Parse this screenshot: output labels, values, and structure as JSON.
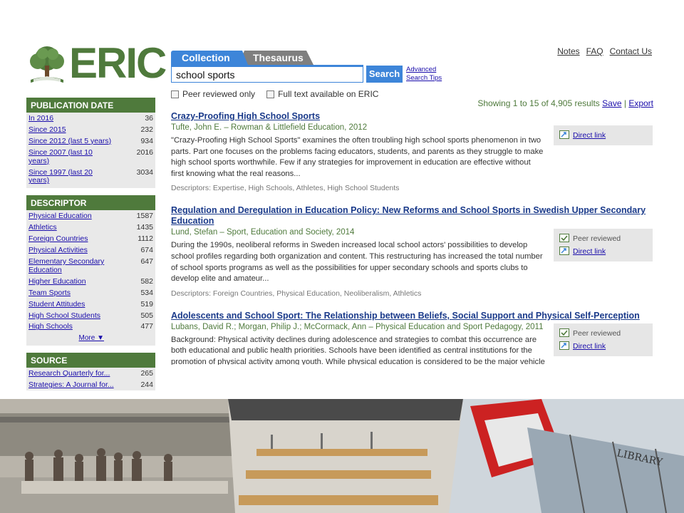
{
  "logo": {
    "text": "ERIC"
  },
  "top_links": [
    "Notes",
    "FAQ",
    "Contact Us"
  ],
  "tabs": {
    "collection": "Collection",
    "thesaurus": "Thesaurus"
  },
  "search": {
    "value": "school sports",
    "button": "Search",
    "advanced": "Advanced",
    "tips": "Search Tips"
  },
  "filters": {
    "peer_reviewed": "Peer reviewed only",
    "full_text": "Full text available on ERIC"
  },
  "result_count": {
    "text": "Showing 1 to 15 of 4,905 results",
    "save": "Save",
    "sep": "|",
    "export": "Export"
  },
  "sidebar": {
    "publication_date": {
      "title": "PUBLICATION DATE",
      "items": [
        {
          "label": "In 2016",
          "count": "36"
        },
        {
          "label": "Since 2015",
          "count": "232"
        },
        {
          "label": "Since 2012 (last 5 years)",
          "count": "934"
        },
        {
          "label": "Since 2007 (last 10 years)",
          "count": "2016"
        },
        {
          "label": "Since 1997 (last 20 years)",
          "count": "3034"
        }
      ]
    },
    "descriptor": {
      "title": "DESCRIPTOR",
      "items": [
        {
          "label": "Physical Education",
          "count": "1587"
        },
        {
          "label": "Athletics",
          "count": "1435"
        },
        {
          "label": "Foreign Countries",
          "count": "1112"
        },
        {
          "label": "Physical Activities",
          "count": "674"
        },
        {
          "label": "Elementary Secondary Education",
          "count": "647"
        },
        {
          "label": "Higher Education",
          "count": "582"
        },
        {
          "label": "Team Sports",
          "count": "534"
        },
        {
          "label": "Student Attitudes",
          "count": "519"
        },
        {
          "label": "High School Students",
          "count": "505"
        },
        {
          "label": "High Schools",
          "count": "477"
        }
      ],
      "more": "More ▼"
    },
    "source": {
      "title": "SOURCE",
      "items": [
        {
          "label": "Research Quarterly for...",
          "count": "265"
        },
        {
          "label": "Strategies: A Journal for...",
          "count": "244"
        }
      ]
    }
  },
  "results": [
    {
      "title": "Crazy-Proofing High School Sports",
      "meta": "Tufte, John E. – Rowman & Littlefield Education, 2012",
      "abstract": "\"Crazy-Proofing High School Sports\" examines the often troubling high school sports phenomenon in two parts. Part one focuses on the problems facing educators, students, and parents as they struggle to make high school sports worthwhile. Few if any strategies for improvement in education are effective without first knowing what the real reasons...",
      "descriptors": "Descriptors: Expertise, High Schools, Athletes, High School Students",
      "peer": "",
      "link": "Direct link"
    },
    {
      "title": "Regulation and Deregulation in Education Policy: New Reforms and School Sports in Swedish Upper Secondary Education",
      "meta": "Lund, Stefan – Sport, Education and Society, 2014",
      "abstract": "During the 1990s, neoliberal reforms in Sweden increased local school actors' possibilities to develop school profiles regarding both organization and content. This restructuring has increased the total number of school sports programs as well as the possibilities for upper secondary schools and sports clubs to develop elite and amateur...",
      "descriptors": "Descriptors: Foreign Countries, Physical Education, Neoliberalism, Athletics",
      "peer": "Peer reviewed",
      "link": "Direct link"
    },
    {
      "title": "Adolescents and School Sport: The Relationship between Beliefs, Social Support and Physical Self-Perception",
      "meta": "Lubans, David R.; Morgan, Philip J.; McCormack, Ann – Physical Education and Sport Pedagogy, 2011",
      "abstract": "Background: Physical activity declines during adolescence and strategies to combat this occurrence are both educational and public health priorities. Schools have been identified as central institutions for the promotion of physical activity among youth. While physical education is considered to be the major vehicle for physical activity promotion...",
      "descriptors": "",
      "peer": "Peer reviewed",
      "link": "Direct link"
    }
  ],
  "photos": {
    "library_sign": "LIBRARY"
  },
  "colors": {
    "eric_green": "#4f7a3c",
    "tab_blue": "#3d85d9",
    "link_blue": "#1a0dab"
  }
}
